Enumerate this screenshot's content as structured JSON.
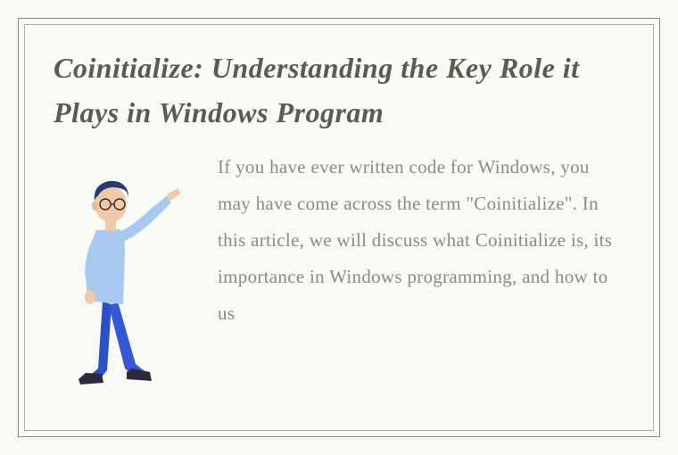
{
  "title": "Coinitialize: Understanding the Key Role it Plays in Windows Program",
  "body": "If you have ever written code for Windows, you may have come across the term \"Coinitialize\". In this article, we will discuss what Coinitialize is, its importance in Windows programming, and how to us"
}
